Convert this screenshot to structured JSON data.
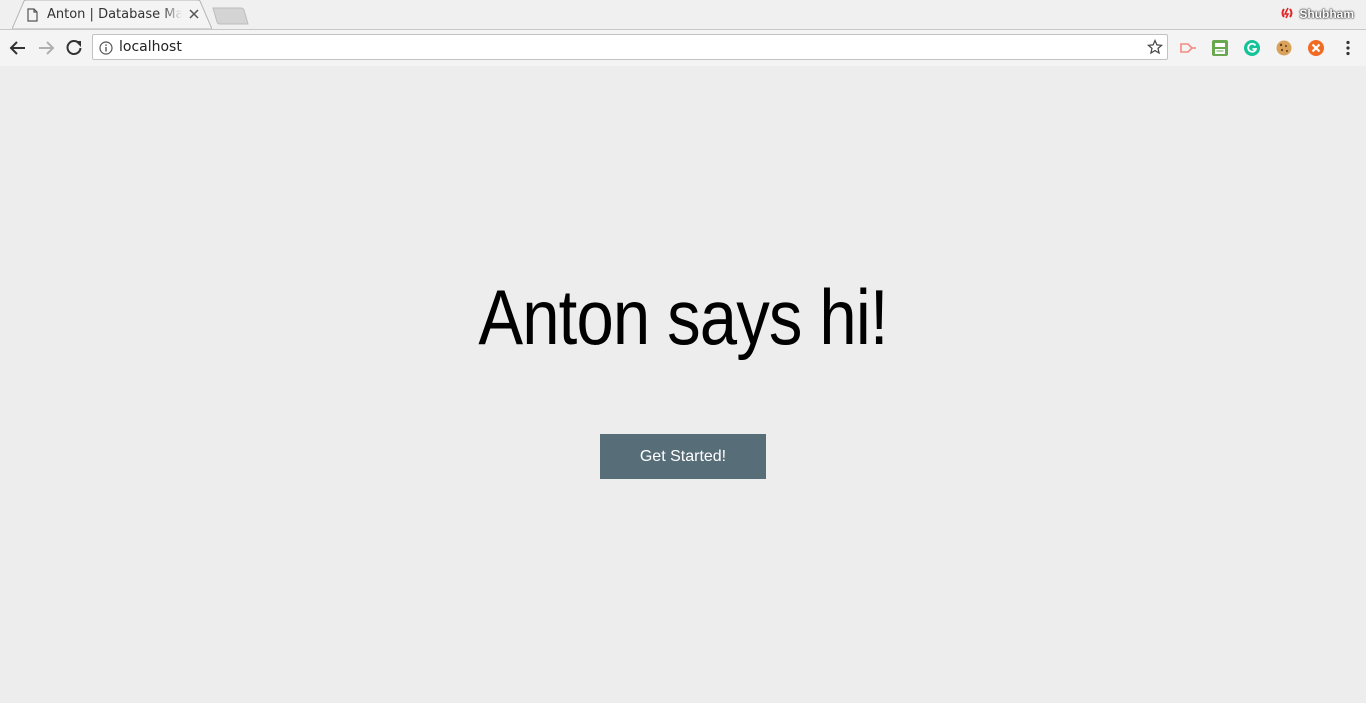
{
  "tab": {
    "title": "Anton | Database Management",
    "close_icon": "close-icon",
    "favicon": "document-icon"
  },
  "profile": {
    "name": "Shubham",
    "icon": "profile-logo-icon"
  },
  "toolbar": {
    "url": "localhost",
    "back_icon": "back-arrow-icon",
    "forward_icon": "forward-arrow-icon",
    "reload_icon": "reload-icon",
    "info_icon": "info-icon",
    "bookmark_icon": "star-icon",
    "extensions": [
      "cast-extension-icon",
      "print-extension-icon",
      "grammarly-icon",
      "cookie-icon",
      "orange-x-extension-icon"
    ],
    "menu_icon": "three-dots-menu-icon"
  },
  "page": {
    "headline": "Anton says hi!",
    "cta_label": "Get Started!"
  },
  "colors": {
    "page_background": "#ededed",
    "cta_background": "#576e79",
    "cta_text": "#ffffff"
  }
}
